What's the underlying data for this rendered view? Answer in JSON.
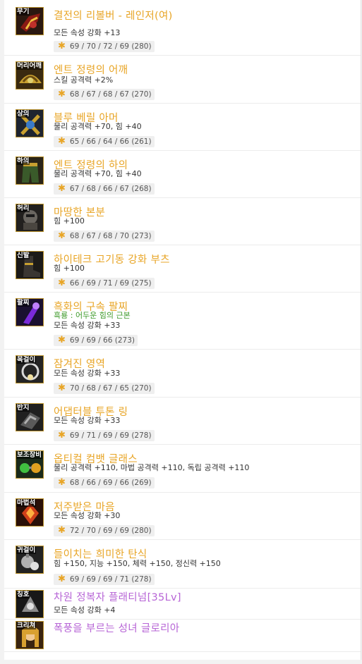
{
  "colors": {
    "unique": "#e8a526",
    "epic": "#b765d6",
    "set_option": "#3e9a2a",
    "star": "#e8a526",
    "border": "#b8902a"
  },
  "items": [
    {
      "slot": "무기",
      "name": "결전의 리볼버 - 레인저(여)",
      "options": [
        "모든 속성 강화 +13"
      ],
      "stat": "69 / 70 / 72 / 69 (280)",
      "icon": "revolver-icon"
    },
    {
      "slot": "머리어깨",
      "name": "엔트 정령의 어깨",
      "options": [
        "스킬 공격력 +2%"
      ],
      "stat": "68 / 67 / 68 / 67 (270)",
      "icon": "shoulder-icon"
    },
    {
      "slot": "상의",
      "name": "블루 베릴 아머",
      "options": [
        "물리 공격력 +70, 힘 +40"
      ],
      "stat": "65 / 66 / 64 / 66 (261)",
      "icon": "armor-icon"
    },
    {
      "slot": "하의",
      "name": "엔트 정령의 하의",
      "options": [
        "물리 공격력 +70, 힘 +40"
      ],
      "stat": "67 / 68 / 66 / 67 (268)",
      "icon": "pants-icon"
    },
    {
      "slot": "허리",
      "name": "마땅한 본분",
      "options": [
        "힘 +100"
      ],
      "stat": "68 / 67 / 68 / 70 (273)",
      "icon": "belt-icon"
    },
    {
      "slot": "신발",
      "name": "하이테크 고기동 강화 부츠",
      "options": [
        "힘 +100"
      ],
      "stat": "66 / 69 / 71 / 69 (275)",
      "icon": "boots-icon"
    },
    {
      "slot": "팔찌",
      "name": "흑화의 구속 팔찌",
      "options": [
        "흑룡 : 어두운 힘의 근본",
        "모든 속성 강화 +33"
      ],
      "stat": "69 / 69 / 66 (273)",
      "icon": "bracelet-icon"
    },
    {
      "slot": "목걸이",
      "name": "잠겨진 영역",
      "options": [
        "모든 속성 강화 +33"
      ],
      "stat": "70 / 68 / 67 / 65 (270)",
      "icon": "necklace-icon"
    },
    {
      "slot": "반지",
      "name": "어댑터블 투톤 링",
      "options": [
        "모든 속성 강화 +33"
      ],
      "stat": "69 / 71 / 69 / 69 (278)",
      "icon": "ring-icon"
    },
    {
      "slot": "보조장비",
      "name": "옵티컬 컴뱃 글래스",
      "options": [
        "물리 공격력 +110, 마법 공격력 +110, 독립 공격력 +110"
      ],
      "stat": "68 / 66 / 69 / 66 (269)",
      "icon": "glasses-icon"
    },
    {
      "slot": "마법석",
      "name": "저주받은 마음",
      "options": [
        "모든 속성 강화 +30"
      ],
      "stat": "72 / 70 / 69 / 69 (280)",
      "icon": "magic-stone-icon"
    },
    {
      "slot": "귀걸이",
      "name": "들이치는 희미한 탄식",
      "options": [
        "힘 +150, 지능 +150, 체력 +150, 정신력 +150"
      ],
      "stat": "69 / 69 / 69 / 71 (278)",
      "icon": "earring-icon"
    },
    {
      "slot": "칭호",
      "name": "차원 정복자 플래티넘[35Lv]",
      "options": [
        "모든 속성 강화 +4"
      ],
      "stat": "",
      "icon": "title-icon"
    },
    {
      "slot": "크리쳐",
      "name": "폭풍을 부르는 성녀 글로리아",
      "options": [],
      "stat": "",
      "icon": "creature-icon"
    }
  ]
}
